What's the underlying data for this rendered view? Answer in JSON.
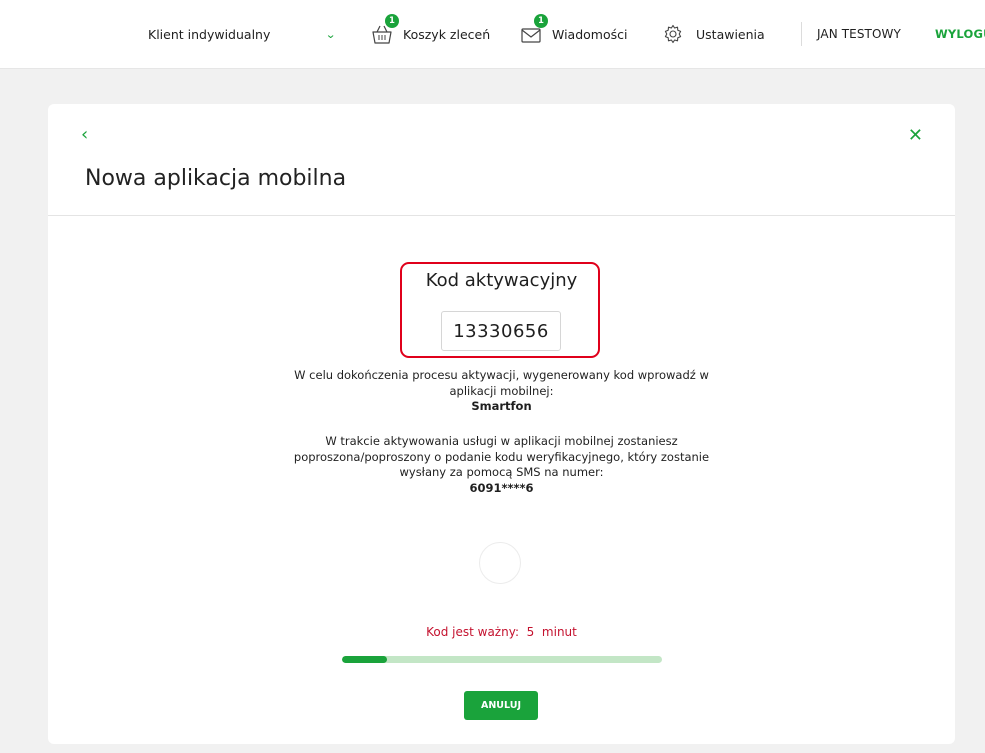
{
  "topbar": {
    "client_select": "Klient indywidualny",
    "basket": {
      "label": "Koszyk zleceń",
      "badge": "1",
      "icon": "basket-icon"
    },
    "messages": {
      "label": "Wiadomości",
      "badge": "1",
      "icon": "envelope-icon"
    },
    "settings": {
      "label": "Ustawienia",
      "icon": "gear-icon"
    },
    "user": "JAN TESTOWY",
    "logout": "WYLOGU"
  },
  "card": {
    "back": "‹",
    "close": "✕",
    "title": "Nowa aplikacja mobilna",
    "code_label": "Kod aktywacyjny",
    "code_value": "13330656",
    "info1_line1": "W celu dokończenia procesu aktywacji, wygenerowany kod wprowadź w",
    "info1_line2": "aplikacji mobilnej:",
    "device": "Smartfon",
    "info2_line1": "W trakcie aktywowania usługi w aplikacji mobilnej zostaniesz",
    "info2_line2": "poproszona/poproszony o podanie kodu weryfikacyjnego, który zostanie",
    "info2_line3": "wysłany za pomocą SMS na numer:",
    "phone": "6091****6",
    "valid_label": "Kod jest ważny:",
    "valid_value": "5",
    "valid_unit": "minut",
    "progress_fraction": 0.14,
    "cancel": "ANULUJ"
  },
  "colors": {
    "accent": "#1aa33b",
    "alert": "#c4122f",
    "progress_track": "#c3e6c6",
    "highlight_border": "#e0001b"
  }
}
